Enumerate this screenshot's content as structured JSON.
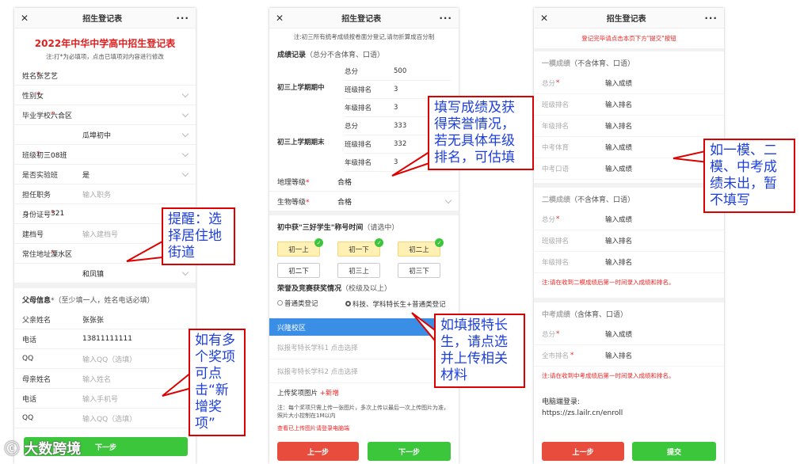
{
  "phone1": {
    "title": "招生登记表",
    "close": "✕",
    "more": "···",
    "heading": "2022年中华中学高中招生登记表",
    "hint": "注:打*为必填项，点击已填项对内容进行修改",
    "rows": [
      {
        "label": "姓名",
        "req": true,
        "value": "张艺艺",
        "chev": false,
        "ph": false
      },
      {
        "label": "性别",
        "req": true,
        "value": "女",
        "chev": true,
        "ph": false
      },
      {
        "label": "毕业学校",
        "req": true,
        "value": "六合区",
        "chev": true,
        "ph": false
      },
      {
        "label": "",
        "req": false,
        "value": "瓜埠初中",
        "chev": true,
        "ph": false
      },
      {
        "label": "班级",
        "req": true,
        "value": "初三08班",
        "chev": true,
        "ph": false
      },
      {
        "label": "是否实验班",
        "req": false,
        "value": "是",
        "chev": true,
        "ph": false
      },
      {
        "label": "担任职务",
        "req": false,
        "value": "输入职务",
        "chev": false,
        "ph": true
      },
      {
        "label": "身份证号",
        "req": true,
        "value": "321",
        "chev": false,
        "ph": false
      },
      {
        "label": "建档号",
        "req": false,
        "value": "输入建档号",
        "chev": false,
        "ph": true
      },
      {
        "label": "常住地址",
        "req": true,
        "value": "溧水区",
        "chev": true,
        "ph": false
      },
      {
        "label": "",
        "req": false,
        "value": "和凤镇",
        "chev": true,
        "ph": false
      }
    ],
    "parent_title": "父母信息",
    "parent_req": "*",
    "parent_note": "（至少填一人，姓名电话必填）",
    "parent_rows": [
      {
        "label": "父亲姓名",
        "value": "张张张",
        "ph": false
      },
      {
        "label": "电话",
        "value": "13811111111",
        "ph": false
      },
      {
        "label": "QQ",
        "value": "输入QQ（选填）",
        "ph": true
      },
      {
        "label": "母亲姓名",
        "value": "输入姓名",
        "ph": true
      },
      {
        "label": "电话",
        "value": "输入手机号",
        "ph": true
      },
      {
        "label": "QQ",
        "value": "输入QQ（选填）",
        "ph": true
      }
    ],
    "next": "下一步"
  },
  "phone2": {
    "title": "招生登记表",
    "close": "✕",
    "more": "···",
    "hint": "注:初三所有统考成绩按卷面分登记,请勿折算成百分制",
    "score_title": "成绩记录",
    "score_note": "（总分不含体育、口语）",
    "term1": "初三上学期期中",
    "term2": "初三上学期期末",
    "t1": [
      {
        "k": "总分",
        "v": "500"
      },
      {
        "k": "班级排名",
        "v": "3"
      },
      {
        "k": "年级排名",
        "v": "3"
      }
    ],
    "t2": [
      {
        "k": "总分",
        "v": "333"
      },
      {
        "k": "班级排名",
        "v": "332"
      },
      {
        "k": "年级排名",
        "v": "3"
      }
    ],
    "geo_label": "地理等级",
    "geo_val": "合格",
    "bio_label": "生物等级",
    "bio_val": "合格",
    "award_title": "初中获\"三好学生\"称号时间",
    "award_note": "（请选中）",
    "chips": [
      "初一上",
      "初一下",
      "初二上",
      "初二下",
      "初三上",
      "初三下"
    ],
    "honor_title": "荣誉及竞赛获奖情况",
    "honor_note": "（校级及以上）",
    "radio1": "普通类登记",
    "radio2": "科技、学科特长生+普通类登记",
    "campus": "兴隆校区",
    "sel1": "拟报考特长学科1 点击选择",
    "sel2": "拟报考特长学科2 点击选择",
    "upload": "上传奖项图片",
    "add": "+新增",
    "upload_note": "注：每个奖项只需上传一张图片，多次上传以最后一次上传图片为准，照片大小控制在1M以内",
    "view": "查看已上传图片请登录电脑端",
    "prev": "上一步",
    "next": "下一步"
  },
  "phone3": {
    "title": "招生登记表",
    "close": "✕",
    "more": "···",
    "hint": "登记完毕请点击本页下方\"提交\"按钮",
    "g1": "一模成绩",
    "g1n": "（不含体育、口语）",
    "g1rows": [
      {
        "k": "总分",
        "req": true,
        "v": "输入成绩"
      },
      {
        "k": "班级排名",
        "req": false,
        "v": "输入排名"
      },
      {
        "k": "年级排名",
        "req": false,
        "v": "输入排名"
      },
      {
        "k": "中考体育",
        "req": false,
        "v": "输入成绩"
      },
      {
        "k": "中考口语",
        "req": false,
        "v": "输入成绩"
      }
    ],
    "g2": "二模成绩",
    "g2n": "（不含体育、口语）",
    "g2rows": [
      {
        "k": "总分",
        "req": true,
        "v": "输入成绩"
      },
      {
        "k": "班级排名",
        "req": false,
        "v": "输入排名"
      },
      {
        "k": "年级排名",
        "req": false,
        "v": "输入排名"
      }
    ],
    "note2": "注:请在收到二模成绩后第一时间录入成绩和排名。",
    "g3": "中考成绩",
    "g3n": "（含体育、口语）",
    "g3rows": [
      {
        "k": "总分",
        "req": true,
        "v": "输入成绩"
      },
      {
        "k": "全市排名",
        "req": true,
        "v": "输入排名"
      }
    ],
    "note3": "注:请在收到中考成绩后第一时间录入成绩和排名。",
    "pc": "电脑端登录:",
    "url": "https://zs.lailr.cn/enroll",
    "prev": "上一步",
    "submit": "提交"
  },
  "callouts": {
    "c1": "提醒：选择居住地街道",
    "c2": "如有多个奖项可点击“新增奖项”",
    "c3": "填写成绩及获得荣誉情况，若无具体年级排名，可估填",
    "c4": "如填报特长生，请点选并上传相关材料",
    "c5": "如一模、二模、中考成绩未出，暂不填写"
  },
  "watermark": "大数跨境"
}
